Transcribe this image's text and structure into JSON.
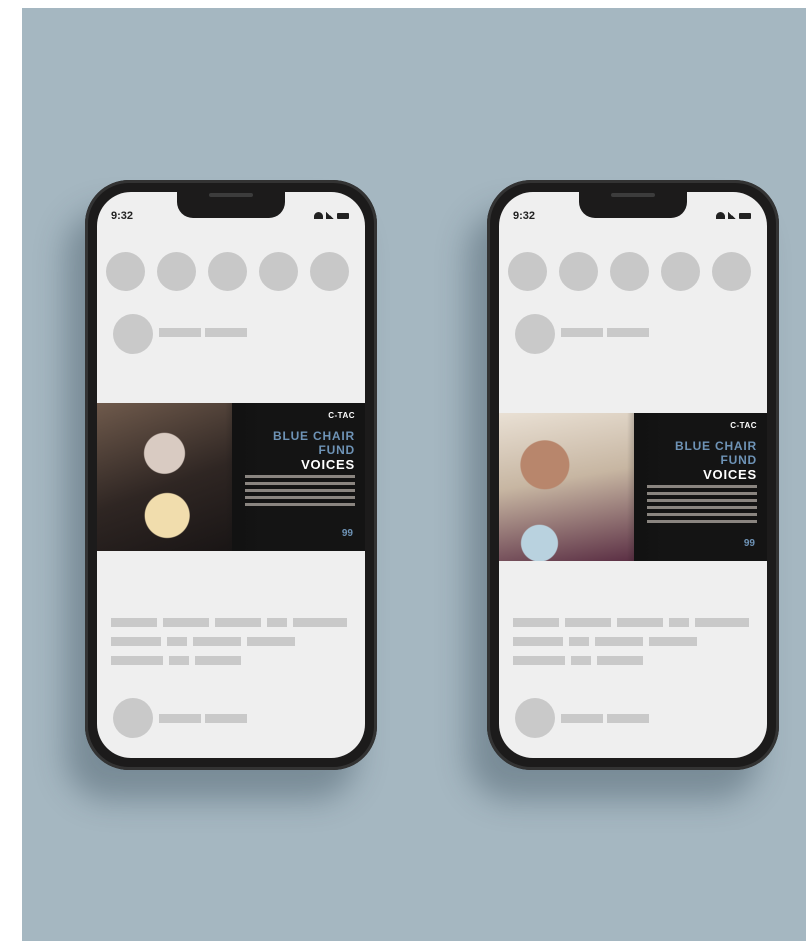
{
  "phones": [
    {
      "status_time": "9:32",
      "banner": {
        "brand": "C-TAC",
        "title_line1": "BLUE CHAIR",
        "title_line2": "FUND",
        "title_line3": "VOICES",
        "quote_mark": "99"
      }
    },
    {
      "status_time": "9:32",
      "banner": {
        "brand": "C-TAC",
        "title_line1": "BLUE CHAIR",
        "title_line2": "FUND",
        "title_line3": "VOICES",
        "quote_mark": "99"
      }
    }
  ],
  "colors": {
    "background": "#a5b7c1",
    "accent_blue": "#6e93b6",
    "placeholder": "#c9c9c9",
    "screen": "#efefef"
  }
}
